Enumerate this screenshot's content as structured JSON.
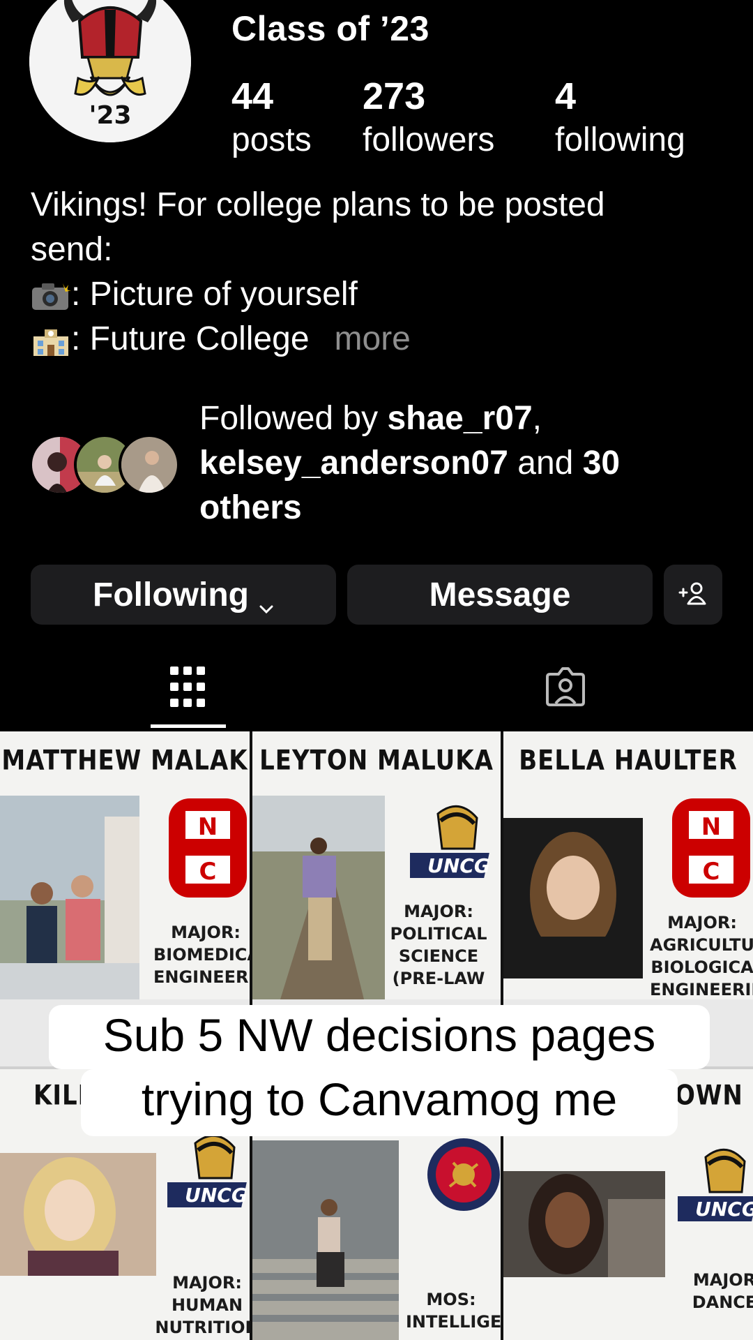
{
  "profile": {
    "class_title": "Class of ’23",
    "avatar_label": "'23",
    "stats": [
      {
        "num": "44",
        "label": "posts"
      },
      {
        "num": "273",
        "label": "followers"
      },
      {
        "num": "4",
        "label": "following"
      }
    ]
  },
  "bio": {
    "line1": "Vikings! For college plans to be posted",
    "line2": "send:",
    "item1": ": Picture of yourself",
    "item2": ": Future College",
    "more": "more"
  },
  "followed_by": {
    "prefix": "Followed by ",
    "user1": "shae_r07",
    "sep": ",",
    "user2": "kelsey_anderson07",
    "and": " and ",
    "count": "30",
    "others": "others"
  },
  "buttons": {
    "following": "Following",
    "message": "Message"
  },
  "posts": [
    {
      "name": "MATTHEW MALAK",
      "major": "MAJOR:\nBIOMEDICA\nENGINEERIN",
      "school": "NC State"
    },
    {
      "name": "LEYTON MALUKA",
      "major": "MAJOR:\nPOLITICAL\nSCIENCE\n(PRE-LAW",
      "school": "UNCG"
    },
    {
      "name": "BELLA HAULTER",
      "major": "MAJOR:\nAGRICULTURA\nBIOLOGICA\nENGINEERIN",
      "school": "NC State"
    },
    {
      "name": "KILE",
      "major": "MAJOR:\nHUMAN\nNUTRITION\nDIETETIC",
      "school": "UNCG"
    },
    {
      "name": "",
      "major": "MOS:\nINTELLIGE",
      "school": "Marine Corps"
    },
    {
      "name": "OWN",
      "major": "MAJOR\nDANCE",
      "school": "UNCG"
    }
  ],
  "caption": {
    "line1": "Sub 5 NW decisions pages",
    "line2": "trying to Canvamog me"
  },
  "colors": {
    "background": "#000000",
    "button_bg": "#1d1d1f",
    "muted_text": "#8e8e8e",
    "ncstate_red": "#cc0000"
  }
}
